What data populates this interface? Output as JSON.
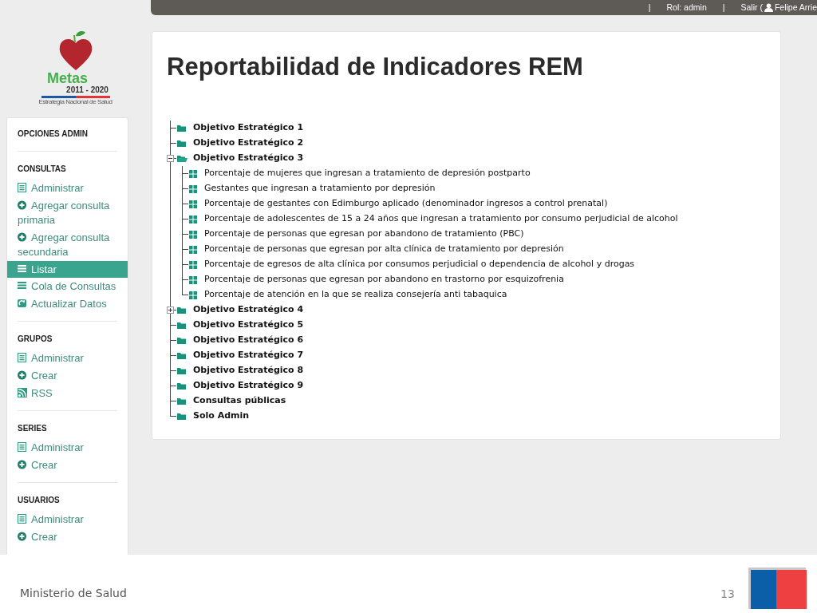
{
  "top_bar": {
    "separators": [
      "|",
      "|"
    ],
    "role": "Rol: admin",
    "logout": "Salir (",
    "user": "Felipe Arrie"
  },
  "logo": {
    "name": "Metas",
    "years": "2011 - 2020",
    "tagline": "Estrategia Nacional de Salud"
  },
  "sidebar": {
    "title": "OPCIONES ADMIN",
    "sections": [
      {
        "title": "CONSULTAS",
        "items": [
          {
            "label": "Administrar",
            "kind": "doc",
            "selected": false
          },
          {
            "label": "Agregar consulta primaria",
            "kind": "add",
            "selected": false
          },
          {
            "label": "Agregar consulta secundaria",
            "kind": "add",
            "selected": false
          },
          {
            "label": "Listar",
            "kind": "list",
            "selected": true
          },
          {
            "label": "Cola de Consultas",
            "kind": "list",
            "selected": false
          },
          {
            "label": "Actualizar Datos",
            "kind": "refresh",
            "selected": false
          }
        ]
      },
      {
        "title": "GRUPOS",
        "items": [
          {
            "label": "Administrar",
            "kind": "doc",
            "selected": false
          },
          {
            "label": "Crear",
            "kind": "add",
            "selected": false
          },
          {
            "label": "RSS",
            "kind": "rss",
            "selected": false
          }
        ]
      },
      {
        "title": "SERIES",
        "items": [
          {
            "label": "Administrar",
            "kind": "doc",
            "selected": false
          },
          {
            "label": "Crear",
            "kind": "add",
            "selected": false
          }
        ]
      },
      {
        "title": "USUARIOS",
        "items": [
          {
            "label": "Administrar",
            "kind": "doc",
            "selected": false
          },
          {
            "label": "Crear",
            "kind": "add",
            "selected": false
          }
        ]
      }
    ]
  },
  "page": {
    "title": "Reportabilidad de Indicadores REM"
  },
  "tree": [
    {
      "label": "Objetivo Estratégico 1",
      "kind": "folder"
    },
    {
      "label": "Objetivo Estratégico 2",
      "kind": "folder"
    },
    {
      "label": "Objetivo Estratégico 3",
      "kind": "folder",
      "expanded": true,
      "children": [
        {
          "label": "Porcentaje de mujeres que ingresan a tratamiento de depresión postparto",
          "kind": "indicator"
        },
        {
          "label": "Gestantes que ingresan a tratamiento por depresión",
          "kind": "indicator"
        },
        {
          "label": "Porcentaje de gestantes con Edimburgo aplicado (denominador ingresos a control prenatal)",
          "kind": "indicator"
        },
        {
          "label": "Porcentaje de adolescentes de 15 a 24 años que ingresan a tratamiento por consumo perjudicial de alcohol",
          "kind": "indicator"
        },
        {
          "label": "Porcentaje de personas que egresan por abandono de tratamiento (PBC)",
          "kind": "indicator"
        },
        {
          "label": "Porcentaje de personas que egresan por alta clínica de tratamiento por depresión",
          "kind": "indicator"
        },
        {
          "label": "Porcentaje de egresos de alta clínica por consumos perjudicial o dependencia de alcohol y drogas",
          "kind": "indicator"
        },
        {
          "label": "Porcentaje de personas que egresan por abandono en trastorno por esquizofrenia",
          "kind": "indicator"
        },
        {
          "label": "Porcentaje de atención en la que se realiza consejería anti tabaquica",
          "kind": "indicator"
        }
      ]
    },
    {
      "label": "Objetivo Estratégico 4",
      "kind": "folder",
      "expanded": false
    },
    {
      "label": "Objetivo Estratégico 5",
      "kind": "folder"
    },
    {
      "label": "Objetivo Estratégico 6",
      "kind": "folder"
    },
    {
      "label": "Objetivo Estratégico 7",
      "kind": "folder"
    },
    {
      "label": "Objetivo Estratégico 8",
      "kind": "folder"
    },
    {
      "label": "Objetivo Estratégico 9",
      "kind": "folder"
    },
    {
      "label": "Consultas públicas",
      "kind": "folder"
    },
    {
      "label": "Solo Admin",
      "kind": "folder"
    }
  ],
  "footer": {
    "org": "Ministerio de Salud",
    "page_number": "13"
  }
}
